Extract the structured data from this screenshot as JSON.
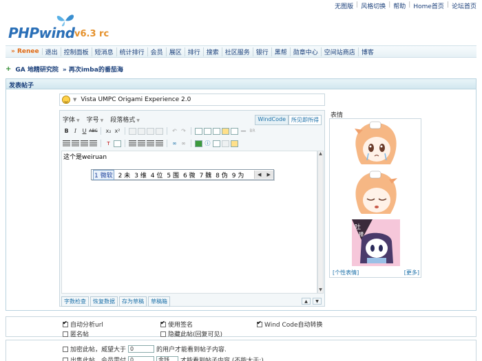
{
  "top_links": [
    "无图版",
    "风格切换",
    "帮助",
    "Home首页",
    "论坛首页"
  ],
  "logo": {
    "brand": "PHPwind",
    "version": "v6.3 rc"
  },
  "nav": {
    "user": "» Renee",
    "items": [
      "退出",
      "控制面板",
      "短消息",
      "统计排行",
      "会员",
      "展区",
      "排行",
      "搜索",
      "社区服务",
      "银行",
      "黑帮",
      "勋章中心",
      "空间站商店",
      "博客"
    ]
  },
  "breadcrumb": {
    "plus": "+",
    "forum": "GA 地精研究院",
    "thread": "» 再次imba的番茄海"
  },
  "panel_title": "发表帖子",
  "post": {
    "title": "Vista UMPC Origami Experience 2.0"
  },
  "toolbar": {
    "font": "字体",
    "size": "字号",
    "paragraph": "段落格式",
    "modes": [
      "WindCode",
      "所见即所得"
    ],
    "bold": "B",
    "italic": "I",
    "underline": "U",
    "strike": "ABC",
    "sub": "x₂",
    "sup": "x²",
    "br": "BR"
  },
  "editor_text": "这个是weiruan",
  "ime": {
    "candidates": [
      "1 微软",
      "2 未",
      "3 维",
      "4 位",
      "5 围",
      "6 微",
      "7 魏",
      "8 伪",
      "9 为"
    ],
    "prev": "◀",
    "next": "▶"
  },
  "editor_footer": [
    "字数检查",
    "恢复数据",
    "存为草稿",
    "草稿箱"
  ],
  "resize": {
    "grow": "▲",
    "shrink": "▼"
  },
  "emotes": {
    "label": "表情",
    "custom_link": "[个性表情]",
    "more_link": "[更多]"
  },
  "options": {
    "auto_url": "自动分析url",
    "signature": "使用签名",
    "windcode": "Wind Code自动转换",
    "anonymous": "匿名帖",
    "hide": "隐藏此帖(回复可见)",
    "encrypt_prefix": "加密此帖，威望大于",
    "encrypt_value": "0",
    "encrypt_suffix": "的用户才能看到帖子内容.",
    "sell_prefix": "出售此帖，会员需付",
    "sell_value": "0",
    "sell_currency": "金钱",
    "sell_suffix": "才能看到帖子内容.(不能大于:)"
  },
  "colors": {
    "link": "#1a3f7a",
    "accent": "#e06a14",
    "brand": "#2a6fb7"
  }
}
